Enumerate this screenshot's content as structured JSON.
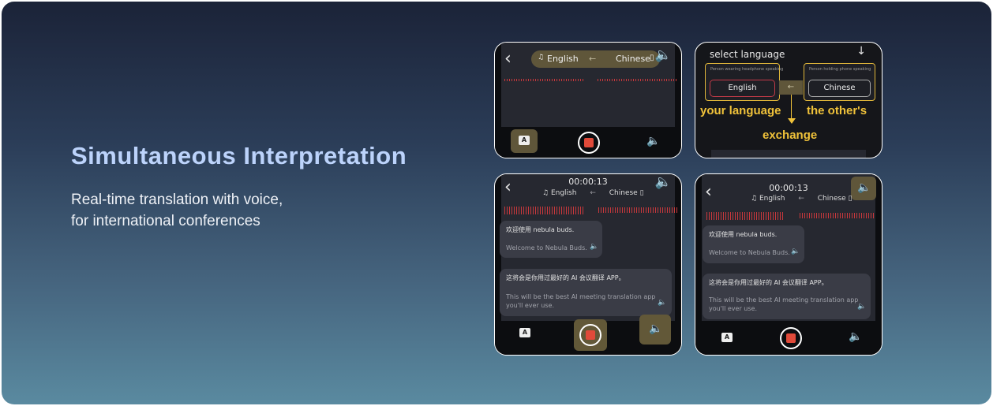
{
  "hero": {
    "title": "Simultaneous Interpretation",
    "subtitle_line1": "Real-time translation with voice,",
    "subtitle_line2": "for international conferences"
  },
  "colors": {
    "accent_gold": "#f0c23a",
    "record_red": "#e04a3a",
    "pill": "#5f563a"
  },
  "icons": {
    "back": "chevron-left-icon",
    "speaker": "speaker-icon",
    "translate": "translate-icon",
    "record": "record-stop-icon",
    "swap": "arrow-left-icon",
    "down": "arrow-down-icon"
  },
  "screen1": {
    "lang_left": "English",
    "arrow": "←",
    "lang_right": "Chinese"
  },
  "screen2": {
    "header": "select language",
    "down_arrow": "↓",
    "tiny_left": "Person wearing headphone speaking",
    "tiny_right": "Person holding phone speaking",
    "btn_left": "English",
    "btn_right": "Chinese",
    "arrow": "←",
    "anno_your": "your language",
    "anno_other": "the other's",
    "anno_exchange": "exchange"
  },
  "screen3": {
    "timer": "00:00:13",
    "lang_left": "English",
    "arrow": "←",
    "lang_right": "Chinese",
    "msg1_cn": "欢迎使用 nebula buds.",
    "msg1_en": "Welcome to Nebula Buds.",
    "msg2_cn": "这将会是你用过最好的 AI 会议翻译 APP。",
    "msg2_en1": "This will be the best AI meeting translation app",
    "msg2_en2": "you'll ever use."
  },
  "screen4": {
    "timer": "00:00:13",
    "lang_left": "English",
    "arrow": "←",
    "lang_right": "Chinese",
    "msg1_cn": "欢迎使用 nebula buds.",
    "msg1_en": "Welcome to Nebula Buds.",
    "msg2_cn": "这将会是你用过最好的 AI 会议翻译 APP。",
    "msg2_en1": "This will be the best AI meeting translation app",
    "msg2_en2": "you'll ever use."
  }
}
